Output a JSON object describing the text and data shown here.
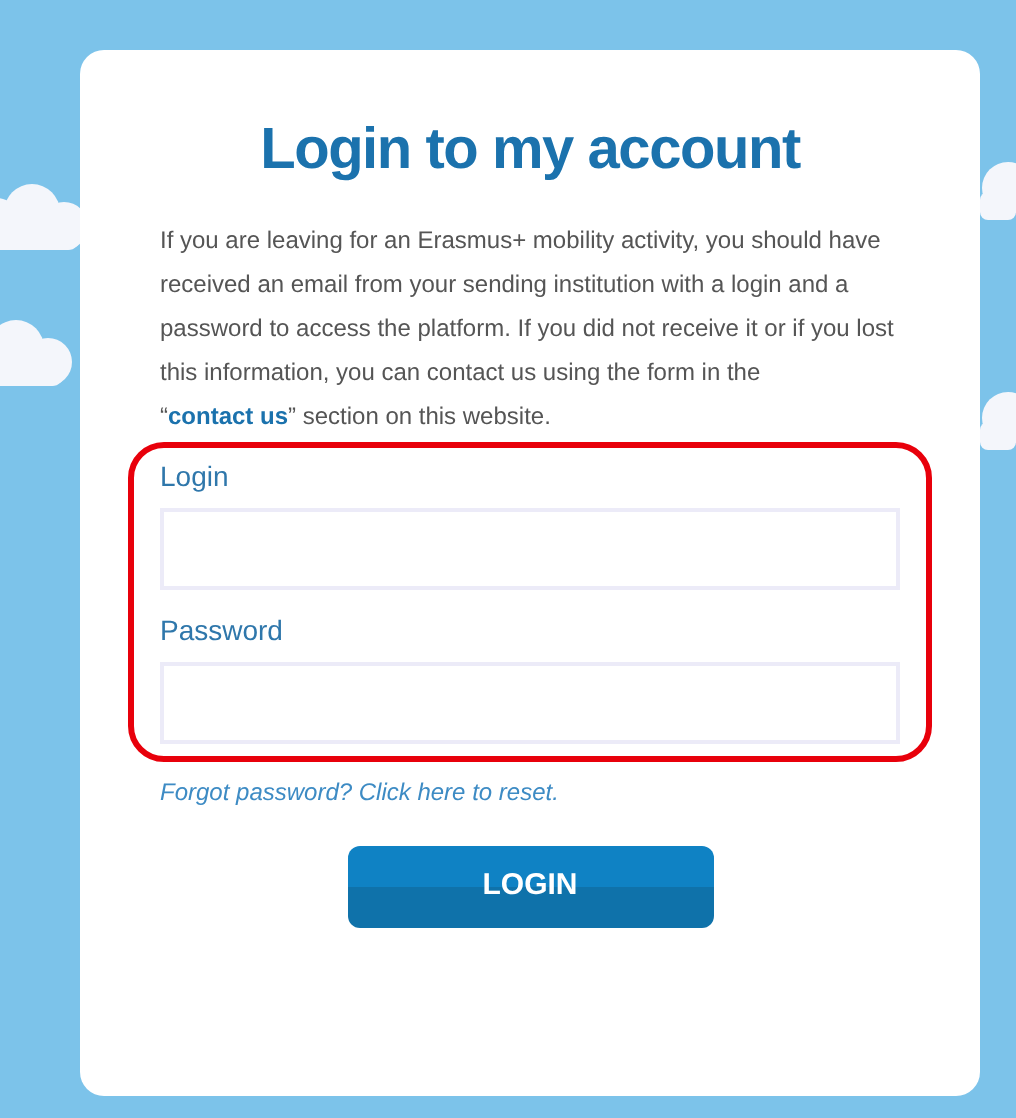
{
  "title": "Login to my account",
  "intro": {
    "before": "If you are leaving for an Erasmus+ mobility activity, you should have received an email from your sending institution with a login and a password to access the platform. If you did not receive it or if you lost this information, you can contact us using the form in the “",
    "link": "contact us",
    "after": "” section on this website."
  },
  "fields": [
    {
      "label": "Login"
    },
    {
      "label": "Password"
    }
  ],
  "forgot_link": "Forgot password? Click here to reset.",
  "button": "LOGIN"
}
